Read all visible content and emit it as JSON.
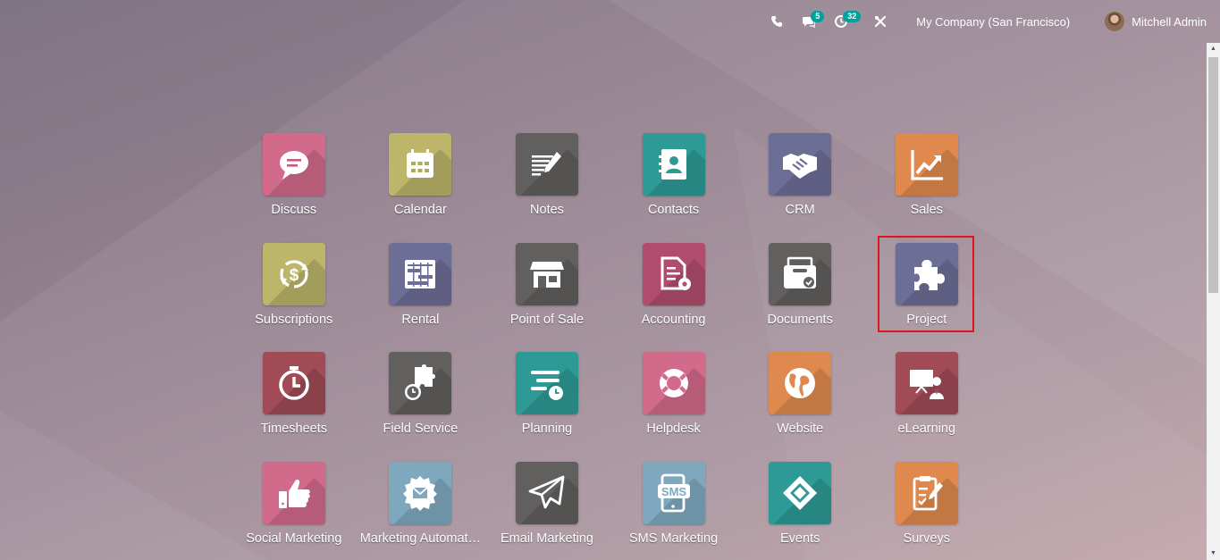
{
  "topbar": {
    "chat_count": "5",
    "activity_count": "32",
    "company": "My Company (San Francisco)",
    "user": "Mitchell Admin"
  },
  "apps": [
    {
      "label": "Discuss",
      "color": "#d26a8c",
      "icon": "chat-bubble-icon"
    },
    {
      "label": "Calendar",
      "color": "#bcb56a",
      "icon": "calendar-icon"
    },
    {
      "label": "Notes",
      "color": "#62605f",
      "icon": "notes-icon"
    },
    {
      "label": "Contacts",
      "color": "#2e9a96",
      "icon": "contact-book-icon"
    },
    {
      "label": "CRM",
      "color": "#6d6e96",
      "icon": "handshake-icon"
    },
    {
      "label": "Sales",
      "color": "#e0894e",
      "icon": "chart-up-icon"
    },
    {
      "label": "Subscriptions",
      "color": "#bcb56a",
      "icon": "dollar-cycle-icon"
    },
    {
      "label": "Rental",
      "color": "#6d6e96",
      "icon": "gantt-icon"
    },
    {
      "label": "Point of Sale",
      "color": "#62605f",
      "icon": "shop-icon"
    },
    {
      "label": "Accounting",
      "color": "#b04d6e",
      "icon": "invoice-gear-icon"
    },
    {
      "label": "Documents",
      "color": "#62605f",
      "icon": "inbox-tray-icon"
    },
    {
      "label": "Project",
      "color": "#6d6e96",
      "icon": "puzzle-icon"
    },
    {
      "label": "Timesheets",
      "color": "#a04b55",
      "icon": "stopwatch-icon"
    },
    {
      "label": "Field Service",
      "color": "#62605f",
      "icon": "puzzle-clock-icon"
    },
    {
      "label": "Planning",
      "color": "#2e9a96",
      "icon": "planning-icon"
    },
    {
      "label": "Helpdesk",
      "color": "#d26a8c",
      "icon": "lifebuoy-icon"
    },
    {
      "label": "Website",
      "color": "#e0894e",
      "icon": "globe-icon"
    },
    {
      "label": "eLearning",
      "color": "#a04b55",
      "icon": "presentation-icon"
    },
    {
      "label": "Social Marketing",
      "color": "#d26a8c",
      "icon": "thumbs-up-icon"
    },
    {
      "label": "Marketing Automat…",
      "color": "#7fa8bf",
      "icon": "gear-mail-icon"
    },
    {
      "label": "Email Marketing",
      "color": "#62605f",
      "icon": "paper-plane-icon"
    },
    {
      "label": "SMS Marketing",
      "color": "#7fa8bf",
      "icon": "sms-phone-icon"
    },
    {
      "label": "Events",
      "color": "#2e9a96",
      "icon": "ticket-icon"
    },
    {
      "label": "Surveys",
      "color": "#e0894e",
      "icon": "clipboard-check-icon"
    }
  ],
  "highlighted_app": "Project"
}
